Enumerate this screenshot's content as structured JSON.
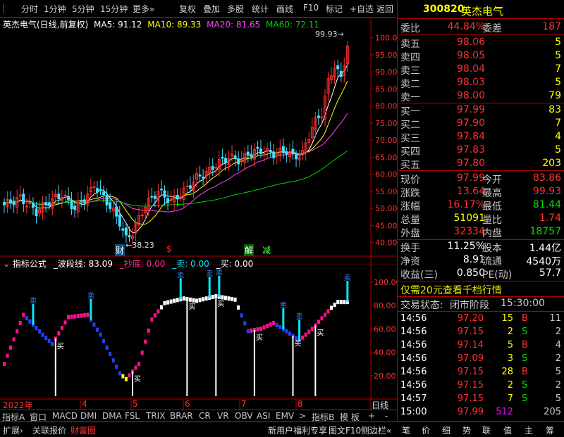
{
  "toolbar": {
    "items": [
      "分时",
      "1分钟",
      "5分钟",
      "15分钟",
      "更多»",
      "复权",
      "叠加",
      "多股",
      "统计",
      "画线",
      "F10",
      "标记",
      "+自选",
      "返回"
    ]
  },
  "chart_header": {
    "title": "英杰电气(日线,前复权)",
    "ma5": "MA5: 91.12",
    "ma10": "MA10: 89.33",
    "ma20": "MA20: 81.65",
    "ma60": "MA60: 72.11"
  },
  "price_axis": [
    "100.0",
    "95.00",
    "90.00",
    "85.00",
    "80.00",
    "75.00",
    "70.00",
    "65.00",
    "60.00",
    "55.00",
    "50.00",
    "45.00",
    "40.00"
  ],
  "price_high_label": "99.93",
  "price_low_label": "38.23",
  "signals": {
    "cai": "财",
    "dollar": "$",
    "jie": "解",
    "jian": "减"
  },
  "indicator_header": {
    "name": "指标公式",
    "bodu_label": "_波段线:",
    "bodu_value": "83.09",
    "chaodi_label": "_抄底:",
    "chaodi_value": "0.00",
    "mai_label": "_卖:",
    "mai_value": "0.00",
    "buy_label": "_买:",
    "buy_value": "0.00"
  },
  "indicator_axis": [
    "100.00",
    "80.00",
    "60.00",
    "40.00",
    "20.00"
  ],
  "marks": {
    "sell": "卖",
    "buy": "买"
  },
  "date_axis": {
    "year": "2022年",
    "months": [
      "4",
      "5",
      "6",
      "7",
      "8"
    ],
    "period": "日线"
  },
  "tabs": [
    "指标A",
    "窗口",
    "MACD",
    "DMI",
    "DMA",
    "FSL",
    "TRIX",
    "BRAR",
    "CR",
    "VR",
    "OBV",
    "ASI",
    "EMV",
    ">",
    "指标B",
    "模 板",
    "+",
    "-"
  ],
  "status_bar": {
    "left": [
      "扩展›",
      "关联报价",
      "财富圈"
    ],
    "promo": "新用户福利专享",
    "right": [
      "图文F10",
      "侧边栏«"
    ],
    "nav": [
      "笔",
      "价",
      "细",
      "势",
      "联",
      "值",
      "主",
      "筹"
    ]
  },
  "quote": {
    "code": "300820",
    "name": "英杰电气",
    "weibi_label": "委比",
    "weibi": "44.84%",
    "weicha_label": "委差",
    "weicha": "187",
    "asks": [
      {
        "label": "卖五",
        "price": "98.06",
        "vol": "5"
      },
      {
        "label": "卖四",
        "price": "98.05",
        "vol": "5"
      },
      {
        "label": "卖三",
        "price": "98.04",
        "vol": "7"
      },
      {
        "label": "卖二",
        "price": "98.03",
        "vol": "5"
      },
      {
        "label": "卖一",
        "price": "98.00",
        "vol": "79"
      }
    ],
    "bids": [
      {
        "label": "买一",
        "price": "97.99",
        "vol": "83"
      },
      {
        "label": "买二",
        "price": "97.90",
        "vol": "7"
      },
      {
        "label": "买三",
        "price": "97.84",
        "vol": "4"
      },
      {
        "label": "买四",
        "price": "97.83",
        "vol": "5"
      },
      {
        "label": "买五",
        "price": "97.80",
        "vol": "203"
      }
    ],
    "stats": [
      {
        "l1": "现价",
        "v1": "97.99",
        "l2": "今开",
        "v2": "83.86"
      },
      {
        "l1": "涨跌",
        "v1": "13.64",
        "l2": "最高",
        "v2": "99.93"
      },
      {
        "l1": "涨幅",
        "v1": "16.17%",
        "l2": "最低",
        "v2": "81.44"
      },
      {
        "l1": "总量",
        "v1": "51091",
        "l2": "量比",
        "v2": "1.74"
      },
      {
        "l1": "外盘",
        "v1": "32334",
        "l2": "内盘",
        "v2": "18757"
      }
    ],
    "fin": [
      {
        "l1": "换手",
        "v1": "11.25%",
        "l2": "股本",
        "v2": "1.44亿"
      },
      {
        "l1": "净资",
        "v1": "8.91",
        "l2": "流通",
        "v2": "4540万"
      },
      {
        "l1": "收益(三)",
        "v1": "0.850",
        "l2": "PE(动)",
        "v2": "57.7"
      }
    ],
    "promo": "仅需20元查看千档行情",
    "trade_state_label": "交易状态:",
    "trade_state": "闭市阶段",
    "trade_time": "15:30:00",
    "ticks": [
      {
        "t": "14:56",
        "p": "97.20",
        "v": "15",
        "s": "B",
        "n": "11"
      },
      {
        "t": "14:56",
        "p": "97.15",
        "v": "2",
        "s": "S",
        "n": "2"
      },
      {
        "t": "14:56",
        "p": "97.14",
        "v": "5",
        "s": "B",
        "n": "4"
      },
      {
        "t": "14:56",
        "p": "97.09",
        "v": "3",
        "s": "S",
        "n": "2"
      },
      {
        "t": "14:56",
        "p": "97.15",
        "v": "28",
        "s": "B",
        "n": "5"
      },
      {
        "t": "14:56",
        "p": "97.15",
        "v": "2",
        "s": "S",
        "n": "2"
      },
      {
        "t": "14:57",
        "p": "97.15",
        "v": "7",
        "s": "S",
        "n": "5"
      },
      {
        "t": "15:00",
        "p": "97.99",
        "v": "512",
        "s": "",
        "n": "205"
      }
    ]
  }
}
